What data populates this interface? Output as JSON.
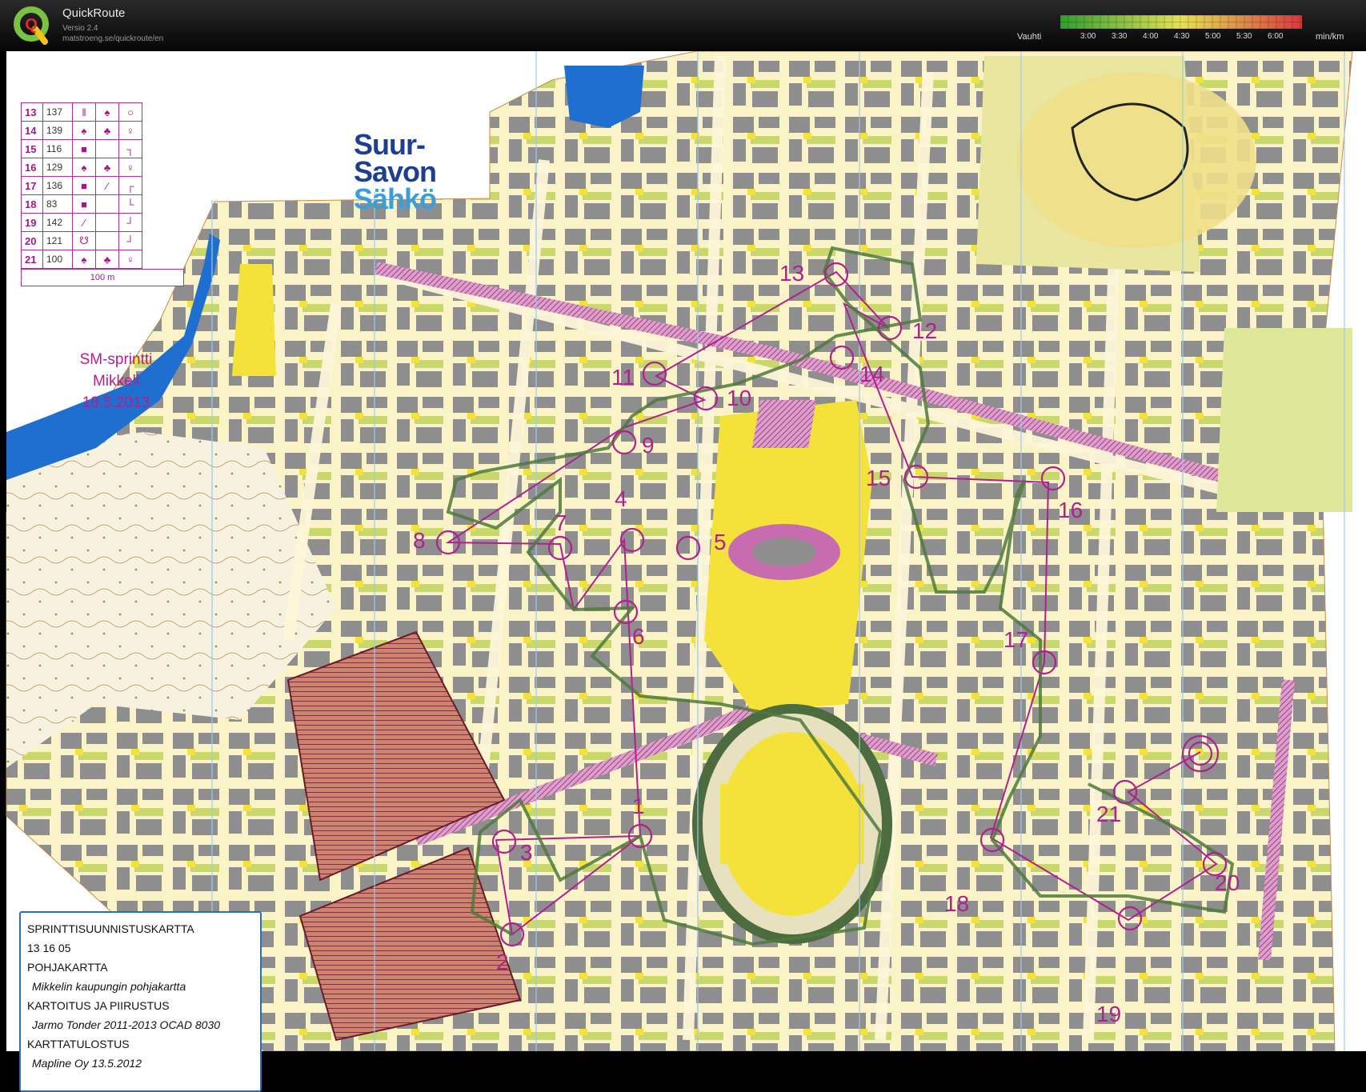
{
  "app": {
    "title": "QuickRoute",
    "version": "Versio 2.4",
    "url": "matstroeng.se/quickroute/en",
    "logo_letter": "Q"
  },
  "pace_legend": {
    "label": "Vauhti",
    "unit": "min/km",
    "ticks": [
      "3:00",
      "3:30",
      "4:00",
      "4:30",
      "5:00",
      "5:30",
      "6:00"
    ],
    "colors": {
      "fast": "#2f9e2f",
      "medium": "#e6e05a",
      "slow": "#d63a3a"
    }
  },
  "control_table": {
    "rows": [
      {
        "num": "13",
        "code": "137",
        "what": "‖",
        "which": "♠",
        "where": "○"
      },
      {
        "num": "14",
        "code": "139",
        "what": "♠",
        "which": "♣",
        "where": "♀"
      },
      {
        "num": "15",
        "code": "116",
        "what": "■",
        "which": "",
        "where": "┐"
      },
      {
        "num": "16",
        "code": "129",
        "what": "♠",
        "which": "♣",
        "where": "♀"
      },
      {
        "num": "17",
        "code": "136",
        "what": "■",
        "which": "⁄",
        "where": "┌"
      },
      {
        "num": "18",
        "code": "83",
        "what": "■",
        "which": "",
        "where": "└"
      },
      {
        "num": "19",
        "code": "142",
        "what": "⁄",
        "which": "",
        "where": "┘"
      },
      {
        "num": "20",
        "code": "121",
        "what": "☋",
        "which": "",
        "where": "┘"
      },
      {
        "num": "21",
        "code": "100",
        "what": "♠",
        "which": "♣",
        "where": "♀"
      }
    ],
    "scale_label": "100 m"
  },
  "brand": {
    "line1": "Suur-",
    "line2": "Savon",
    "line3": "Sähkö"
  },
  "event": {
    "name": "SM-sprintti",
    "city": "Mikkeli",
    "date": "18.5.2013"
  },
  "info_box": {
    "lines": [
      "SPRINTTISUUNNISTUSKARTTA",
      "13 16 05",
      "POHJAKARTTA",
      "Mikkelin kaupungin pohjakartta",
      "KARTOITUS JA PIIRUSTUS",
      "Jarmo Tonder 2011-2013 OCAD 8030",
      "KARTTATULOSTUS",
      "Mapline Oy  13.5.2012"
    ]
  },
  "controls": [
    "1",
    "2",
    "3",
    "4",
    "5",
    "6",
    "7",
    "8",
    "9",
    "10",
    "11",
    "12",
    "13",
    "14",
    "15",
    "16",
    "17",
    "18",
    "19",
    "20",
    "21"
  ],
  "map_colors": {
    "paper": "#fbf3c8",
    "building": "#8e8e8e",
    "open": "#f4e23a",
    "vegetation": "#c9d86a",
    "water": "#1e6fd0",
    "course": "#b0208f",
    "forbidden": "#a24a5a",
    "route": "#4f7a3c"
  }
}
